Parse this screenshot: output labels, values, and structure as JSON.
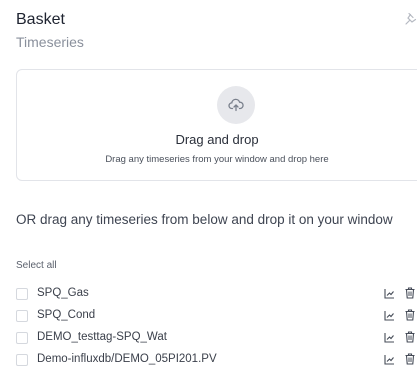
{
  "panel": {
    "title": "Basket",
    "subtitle": "Timeseries"
  },
  "dropzone": {
    "title": "Drag and drop",
    "subtitle": "Drag any timeseries from your window and drop here"
  },
  "instruction": "OR drag any timeseries from below and drop it on your window",
  "select_all_label": "Select all",
  "items": [
    {
      "label": "SPQ_Gas"
    },
    {
      "label": "SPQ_Cond"
    },
    {
      "label": "DEMO_testtag-SPQ_Wat"
    },
    {
      "label": "Demo-influxdb/DEMO_05PI201.PV"
    }
  ],
  "icons": {
    "pin": "pin-icon",
    "upload": "upload-cloud-icon",
    "chart": "line-chart-icon",
    "delete": "trash-icon"
  }
}
